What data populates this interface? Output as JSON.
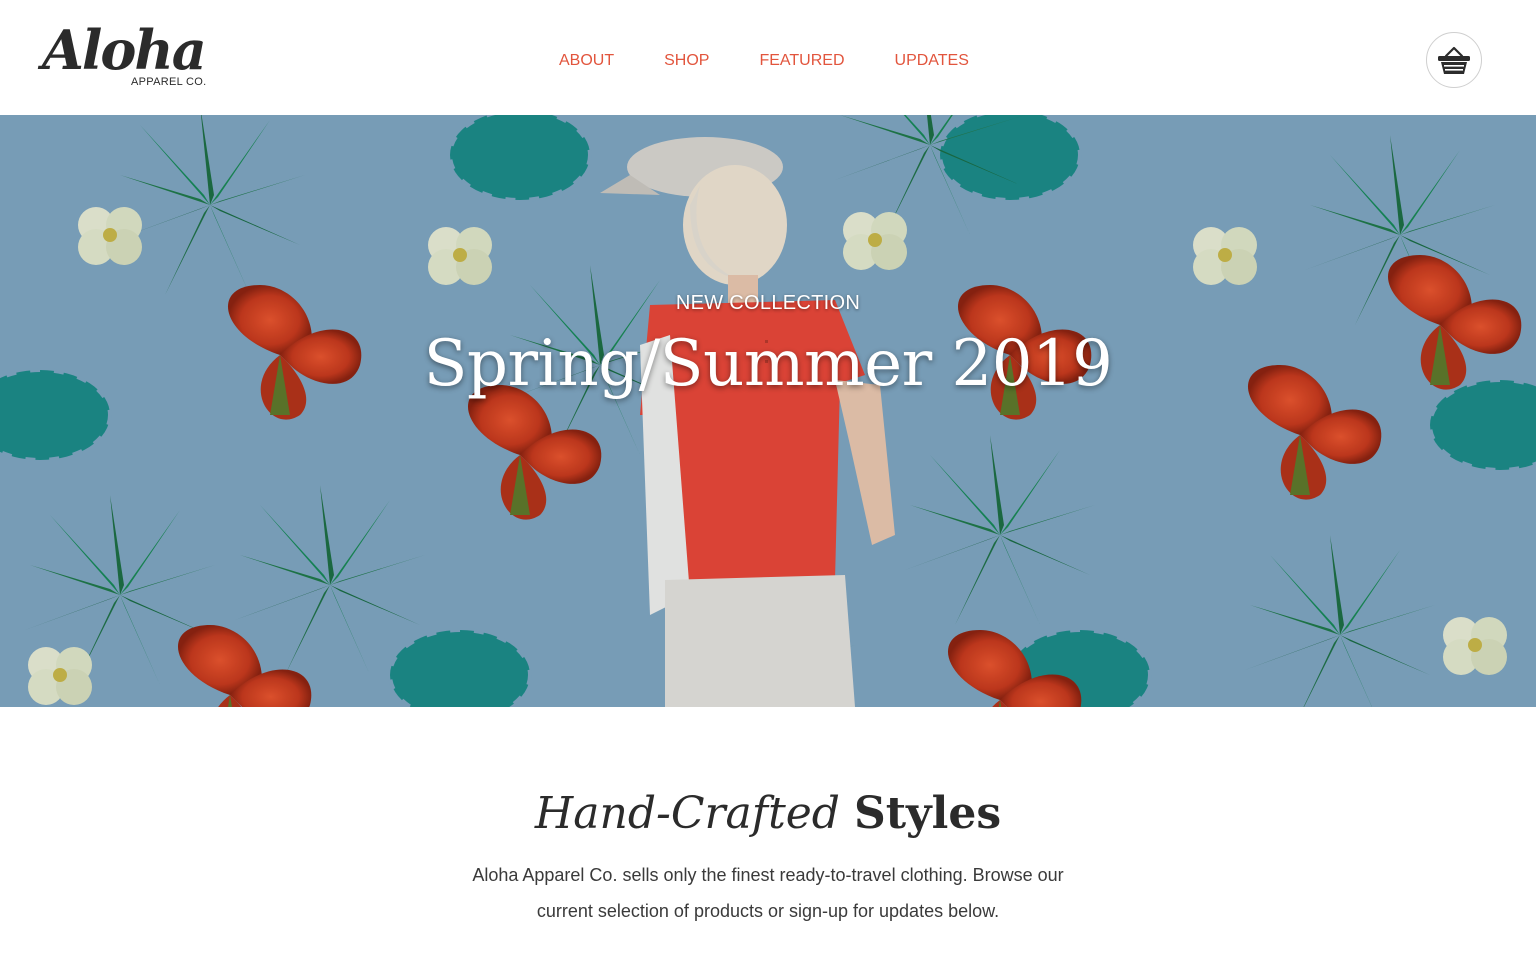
{
  "header": {
    "logo_script": "Aloha",
    "logo_sub": "APPAREL CO.",
    "nav": [
      "ABOUT",
      "SHOP",
      "FEATURED",
      "UPDATES"
    ],
    "cart_icon": "basket-icon"
  },
  "hero": {
    "eyebrow": "NEW COLLECTION",
    "title": "Spring/Summer 2019"
  },
  "intro": {
    "title_italic": "Hand-Crafted",
    "title_bold": "Styles",
    "body": "Aloha Apparel Co. sells only the finest ready-to-travel clothing. Browse our current selection of products or sign-up for updates below."
  },
  "colors": {
    "accent": "#e2553d",
    "hero_bg": "#7fa6c2",
    "text_dark": "#2b2b2b"
  }
}
